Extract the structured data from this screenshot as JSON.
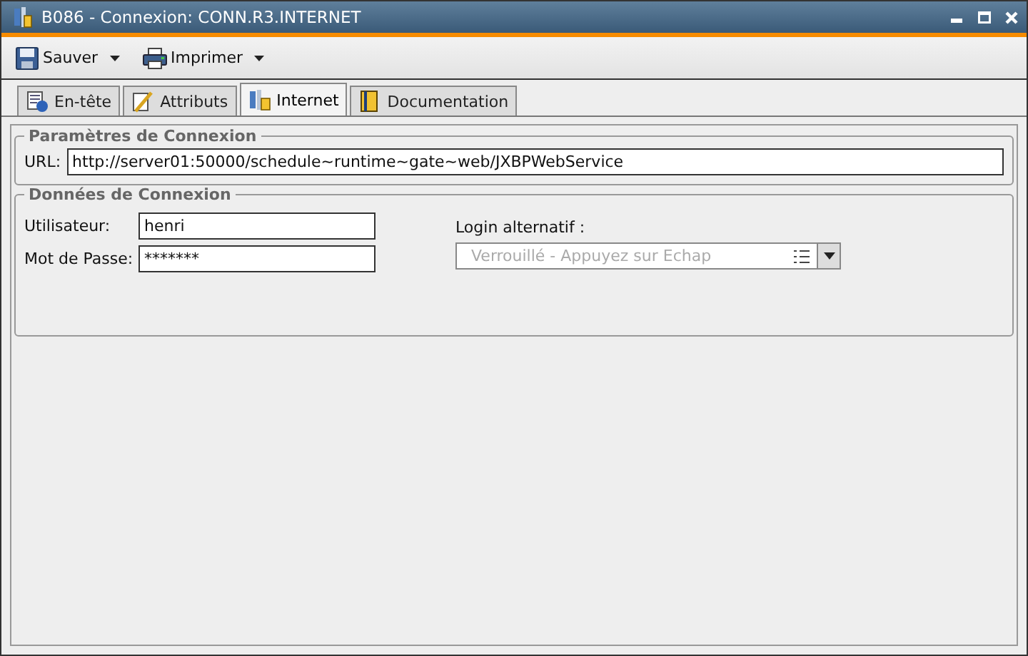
{
  "window": {
    "title": "B086 - Connexion: CONN.R3.INTERNET"
  },
  "toolbar": [
    {
      "label": "Sauver",
      "kind": "save"
    },
    {
      "label": "Imprimer",
      "kind": "print"
    }
  ],
  "tabs": [
    {
      "label": "En-tête",
      "kind": "info",
      "selected": false
    },
    {
      "label": "Attributs",
      "kind": "edit",
      "selected": false
    },
    {
      "label": "Internet",
      "kind": "net",
      "selected": true
    },
    {
      "label": "Documentation",
      "kind": "doc",
      "selected": false
    }
  ],
  "connection_params": {
    "title": "Paramètres de Connexion",
    "url_label": "URL:",
    "url": "http://server01:50000/schedule~runtime~gate~web/JXBPWebService"
  },
  "connection_data": {
    "title": "Données de Connexion",
    "fields": [
      {
        "label": "Utilisateur:",
        "value": "henri"
      },
      {
        "label": "Mot de Passe:",
        "value": "*******"
      }
    ],
    "alt_login": {
      "label": "Login alternatif :",
      "value": "Verrouillé - Appuyez sur Echap",
      "disabled": true
    }
  }
}
